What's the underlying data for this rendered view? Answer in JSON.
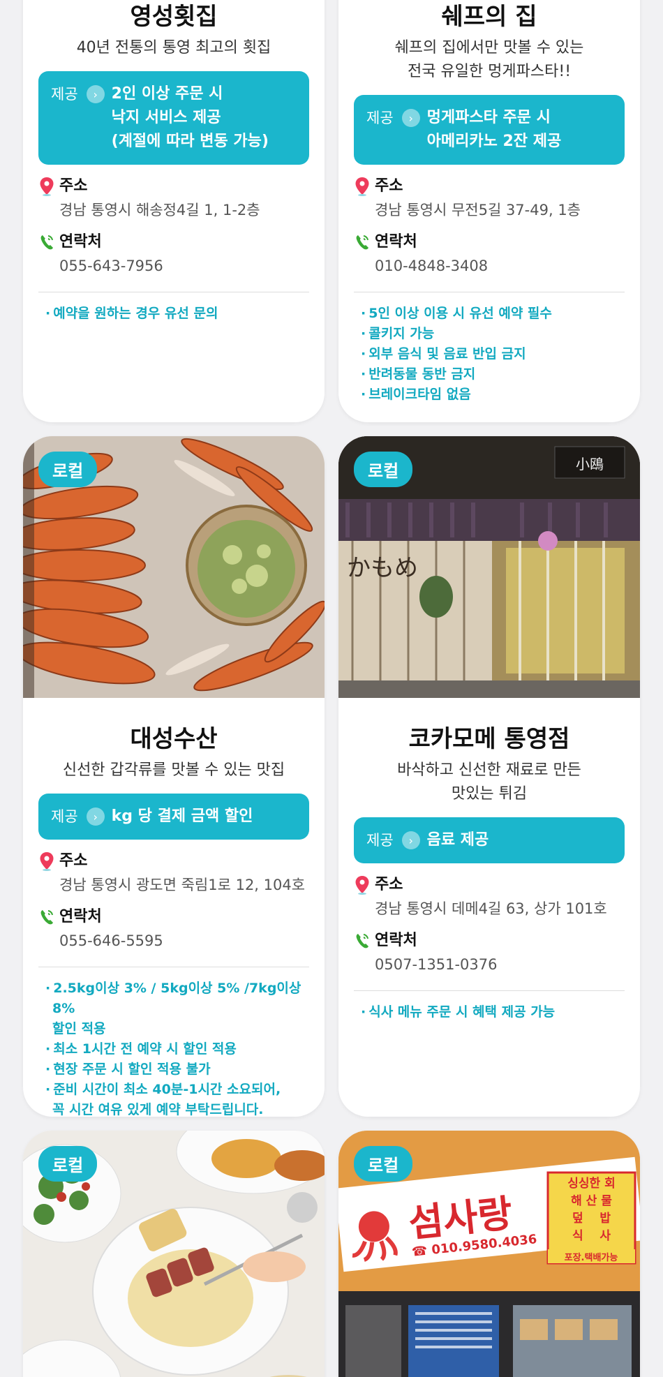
{
  "cards": [
    {
      "name": "영성횟집",
      "desc": "40년 전통의 통영 최고의 횟집",
      "offer_tag": "제공",
      "offer_text": "2인 이상 주문 시\n낙지 서비스 제공\n(계절에 따라 변동 가능)",
      "address_label": "주소",
      "address": "경남 통영시 해송정4길 1, 1-2층",
      "contact_label": "연락처",
      "phone": "055-643-7956",
      "notes": [
        "예약을 원하는 경우 유선 문의"
      ]
    },
    {
      "name": "쉐프의 집",
      "desc": "쉐프의 집에서만 맛볼 수 있는\n전국 유일한 멍게파스타!!",
      "offer_tag": "제공",
      "offer_text": "멍게파스타 주문 시\n아메리카노 2잔 제공",
      "address_label": "주소",
      "address": "경남 통영시 무전5길 37-49, 1층",
      "contact_label": "연락처",
      "phone": "010-4848-3408",
      "notes": [
        "5인 이상 이용 시 유선 예약 필수",
        "콜키지 가능",
        "외부 음식 및 음료 반입 금지",
        "반려동물 동반 금지",
        "브레이크타임 없음"
      ]
    },
    {
      "badge": "로컬",
      "name": "대성수산",
      "desc": "신선한 갑각류를 맛볼 수 있는 맛집",
      "offer_tag": "제공",
      "offer_text": "kg 당 결제 금액 할인",
      "address_label": "주소",
      "address": "경남 통영시 광도면 죽림1로 12, 104호",
      "contact_label": "연락처",
      "phone": "055-646-5595",
      "notes": [
        "2.5kg이상 3% / 5kg이상 5% /7kg이상 8%\n할인 적용",
        "최소 1시간 전 예약 시 할인 적용",
        "현장 주문 시 할인 적용 불가",
        "준비 시간이 최소 40분-1시간 소요되어,\n꼭 시간 여유 있게 예약 부탁드립니다."
      ]
    },
    {
      "badge": "로컬",
      "name": "코카모메 통영점",
      "desc": "바삭하고 신선한 재료로 만든\n맛있는 튀김",
      "offer_tag": "제공",
      "offer_text": "음료 제공",
      "address_label": "주소",
      "address": "경남 통영시 데메4길 63, 상가 101호",
      "contact_label": "연락처",
      "phone": "0507-1351-0376",
      "notes": [
        "식사 메뉴 주문 시 혜택 제공 가능"
      ],
      "sign_jp": "かもめ",
      "sign_small": "小鴎"
    },
    {
      "badge": "로컬"
    },
    {
      "badge": "로컬",
      "sign_name": "섬사랑",
      "sign_phone": "☎ 010.9580.4036",
      "sign_menu": "싱싱한 회\n해 산 물\n덮    밥\n식    사",
      "sign_delivery": "포장.택배가능"
    }
  ],
  "colors": {
    "accent": "#1bb6cc",
    "note": "#12a9c0",
    "pin": "#ee3b5b",
    "phone_icon": "#3aaa35"
  },
  "icons": {
    "address": "location-pin-icon",
    "contact": "phone-icon",
    "offer": "chevron-right-icon"
  }
}
